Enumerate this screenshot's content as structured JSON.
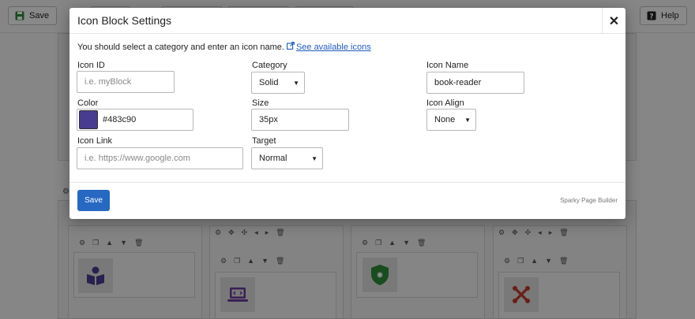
{
  "toolbar": {
    "save_label": "Save",
    "help_label": "Help"
  },
  "modal": {
    "title": "Icon Block Settings",
    "close_label": "✕",
    "intro_text": "You should select a category and enter an icon name.",
    "intro_link": "See available icons",
    "icon_id": {
      "label": "Icon ID",
      "placeholder": "i.e. myBlock"
    },
    "category": {
      "label": "Category",
      "value": "Solid"
    },
    "icon_name": {
      "label": "Icon Name",
      "value": "book-reader"
    },
    "color": {
      "label": "Color",
      "value": "#483c90",
      "swatch": "#483c90"
    },
    "size": {
      "label": "Size",
      "value": "35px"
    },
    "icon_align": {
      "label": "Icon Align",
      "value": "None"
    },
    "icon_link": {
      "label": "Icon Link",
      "placeholder": "i.e. https://www.google.com"
    },
    "target": {
      "label": "Target",
      "value": "Normal"
    },
    "save_label": "Save",
    "brand": "Sparky Page Builder"
  },
  "background_icons": [
    {
      "name": "book-reader-icon",
      "color": "#483c90"
    },
    {
      "name": "laptop-code-icon",
      "color": "#6b3a9c"
    },
    {
      "name": "shield-icon",
      "color": "#2e8b3a"
    },
    {
      "name": "joomla-icon",
      "color": "#c0392b"
    }
  ]
}
